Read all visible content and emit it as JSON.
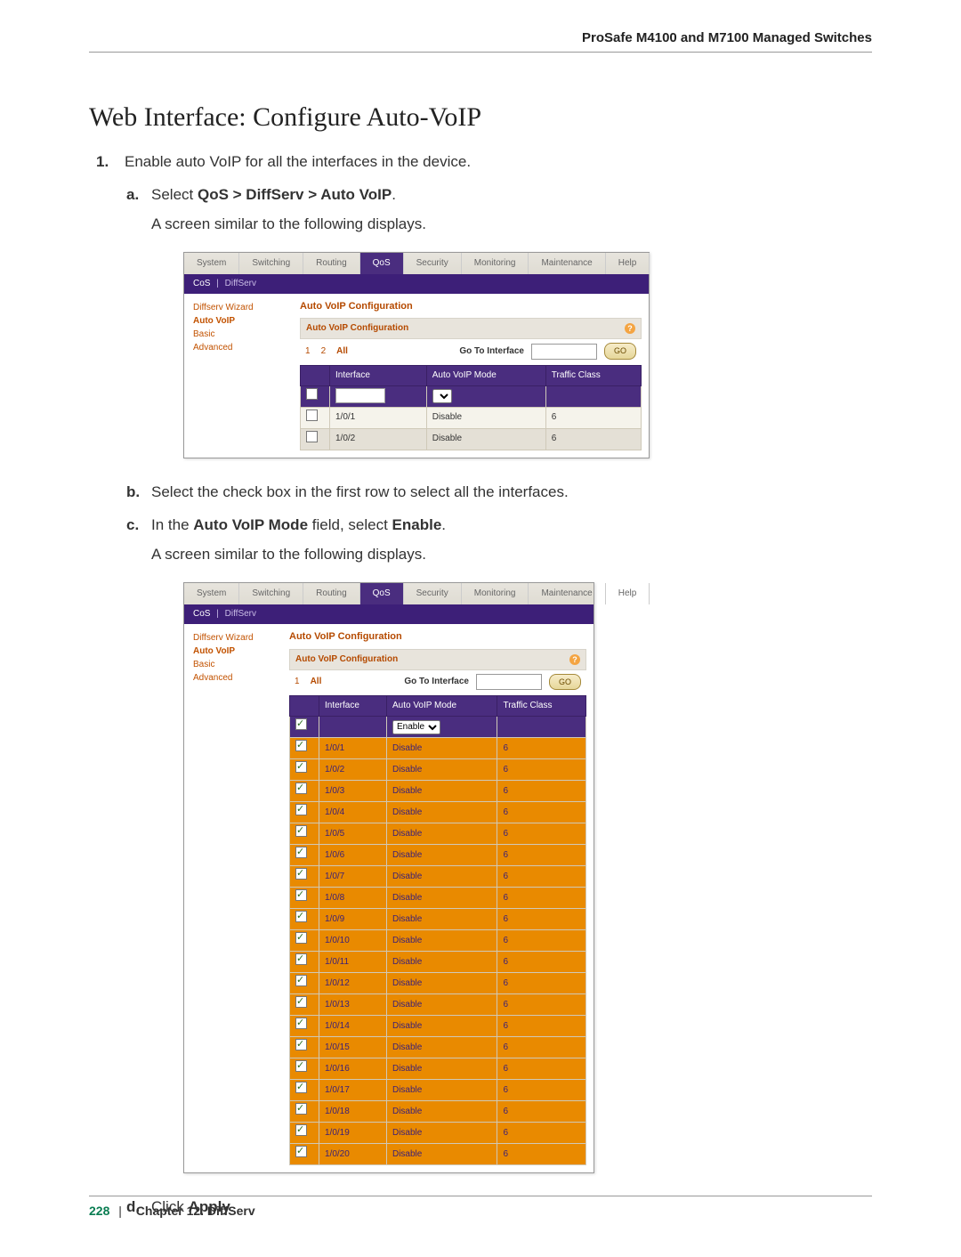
{
  "header": {
    "device_line": "ProSafe M4100 and M7100 Managed Switches"
  },
  "section_title": "Web Interface: Configure Auto-VoIP",
  "steps": {
    "s1_num": "1.",
    "s1_text": "Enable auto VoIP for all the interfaces in the device.",
    "a_letter": "a.",
    "a_prefix": "Select ",
    "a_bold": "QoS > DiffServ > Auto VoIP",
    "a_suffix": ".",
    "a_line2": "A screen similar to the following displays.",
    "b_letter": "b.",
    "b_text": "Select the check box in the first row to select all the interfaces.",
    "c_letter": "c.",
    "c_prefix": "In the ",
    "c_bold1": "Auto VoIP Mode",
    "c_mid": " field, select ",
    "c_bold2": "Enable",
    "c_suffix": ".",
    "c_line2": "A screen similar to the following displays.",
    "d_letter": "d.",
    "d_prefix": "Click ",
    "d_bold": "Apply",
    "d_suffix": "."
  },
  "top_tabs": {
    "t1": "System",
    "t2": "Switching",
    "t3": "Routing",
    "t4": "QoS",
    "t5": "Security",
    "t6": "Monitoring",
    "t7": "Maintenance",
    "t8": "Help"
  },
  "subbar": {
    "cos": "CoS",
    "diffserv": "DiffServ"
  },
  "sidenav": {
    "i1": "Diffserv Wizard",
    "i2": "Auto VoIP",
    "i3": "Basic",
    "i4": "Advanced"
  },
  "cfg": {
    "title": "Auto VoIP Configuration",
    "subtitle": "Auto VoIP Configuration",
    "page1": "1",
    "page2": "2",
    "all": "All",
    "goto": "Go To Interface",
    "go": "GO",
    "h_iface": "Interface",
    "h_mode": "Auto VoIP Mode",
    "h_tc": "Traffic Class",
    "enable_opt": "Enable"
  },
  "shot1_rows": [
    {
      "iface": "1/0/1",
      "mode": "Disable",
      "tc": "6"
    },
    {
      "iface": "1/0/2",
      "mode": "Disable",
      "tc": "6"
    }
  ],
  "shot2_rows": [
    {
      "iface": "1/0/1",
      "mode": "Disable",
      "tc": "6"
    },
    {
      "iface": "1/0/2",
      "mode": "Disable",
      "tc": "6"
    },
    {
      "iface": "1/0/3",
      "mode": "Disable",
      "tc": "6"
    },
    {
      "iface": "1/0/4",
      "mode": "Disable",
      "tc": "6"
    },
    {
      "iface": "1/0/5",
      "mode": "Disable",
      "tc": "6"
    },
    {
      "iface": "1/0/6",
      "mode": "Disable",
      "tc": "6"
    },
    {
      "iface": "1/0/7",
      "mode": "Disable",
      "tc": "6"
    },
    {
      "iface": "1/0/8",
      "mode": "Disable",
      "tc": "6"
    },
    {
      "iface": "1/0/9",
      "mode": "Disable",
      "tc": "6"
    },
    {
      "iface": "1/0/10",
      "mode": "Disable",
      "tc": "6"
    },
    {
      "iface": "1/0/11",
      "mode": "Disable",
      "tc": "6"
    },
    {
      "iface": "1/0/12",
      "mode": "Disable",
      "tc": "6"
    },
    {
      "iface": "1/0/13",
      "mode": "Disable",
      "tc": "6"
    },
    {
      "iface": "1/0/14",
      "mode": "Disable",
      "tc": "6"
    },
    {
      "iface": "1/0/15",
      "mode": "Disable",
      "tc": "6"
    },
    {
      "iface": "1/0/16",
      "mode": "Disable",
      "tc": "6"
    },
    {
      "iface": "1/0/17",
      "mode": "Disable",
      "tc": "6"
    },
    {
      "iface": "1/0/18",
      "mode": "Disable",
      "tc": "6"
    },
    {
      "iface": "1/0/19",
      "mode": "Disable",
      "tc": "6"
    },
    {
      "iface": "1/0/20",
      "mode": "Disable",
      "tc": "6"
    }
  ],
  "footer": {
    "page": "228",
    "sep": "|",
    "chapter": "Chapter 12.  DiffServ"
  }
}
